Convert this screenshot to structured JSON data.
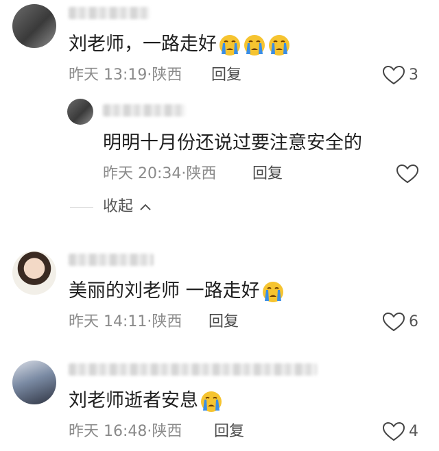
{
  "comments": [
    {
      "text": "刘老师，一路走好",
      "emoji_count": 3,
      "date": "昨天",
      "time": "13:19",
      "location": "陕西",
      "reply_label": "回复",
      "likes": "3",
      "avatar_icon": "avatar-gray-photo"
    },
    {
      "text": "美丽的刘老师 一路走好",
      "emoji_count": 1,
      "date": "昨天",
      "time": "14:11",
      "location": "陕西",
      "reply_label": "回复",
      "likes": "6",
      "avatar_icon": "avatar-child-photo"
    },
    {
      "text": "刘老师逝者安息",
      "emoji_count": 1,
      "date": "昨天",
      "time": "16:48",
      "location": "陕西",
      "reply_label": "回复",
      "likes": "4",
      "avatar_icon": "avatar-anime-photo"
    }
  ],
  "reply": {
    "text": "明明十月份还说过要注意安全的",
    "date": "昨天",
    "time": "20:34",
    "location": "陕西",
    "reply_label": "回复",
    "avatar_icon": "avatar-gray-photo"
  },
  "collapse_label": "收起",
  "colors": {
    "meta": "#8a8a8a",
    "emoji_face": "#f6c430",
    "tears": "#3a8ee6"
  }
}
